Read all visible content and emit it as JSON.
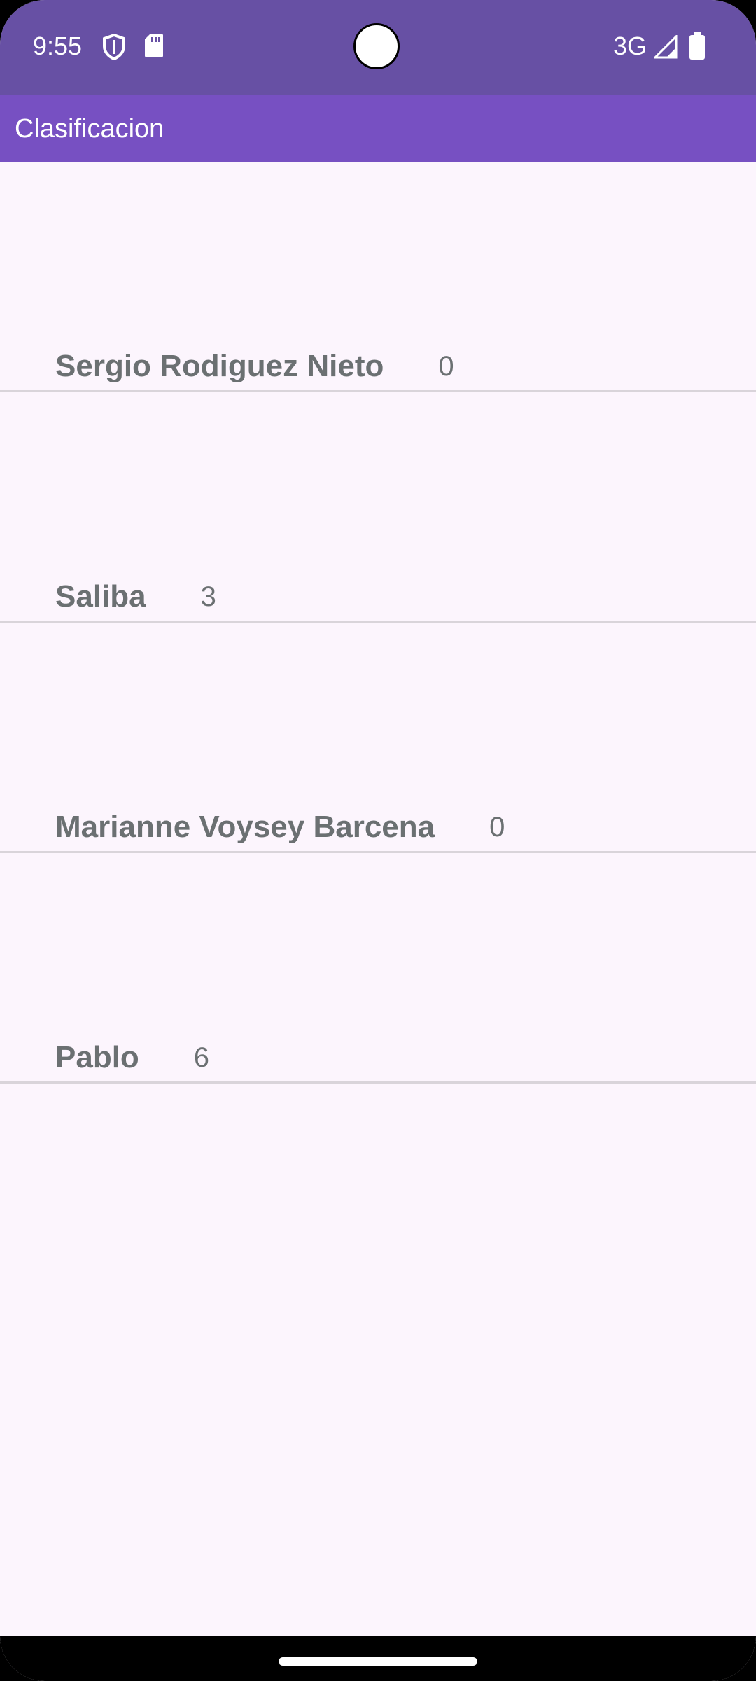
{
  "status_bar": {
    "time": "9:55",
    "network": "3G",
    "icons": [
      "shield-icon",
      "sd-card-icon",
      "signal-icon",
      "battery-icon"
    ],
    "color": "#6750a4"
  },
  "app_bar": {
    "title": "Clasificacion",
    "color": "#7750c2"
  },
  "players": [
    {
      "name": "Sergio Rodiguez Nieto",
      "score": "0"
    },
    {
      "name": "Saliba",
      "score": "3"
    },
    {
      "name": "Marianne Voysey Barcena",
      "score": "0"
    },
    {
      "name": "Pablo",
      "score": "6"
    }
  ],
  "colors": {
    "background": "#fcf5fd",
    "text": "#6b7072",
    "divider": "#d9d4da"
  }
}
